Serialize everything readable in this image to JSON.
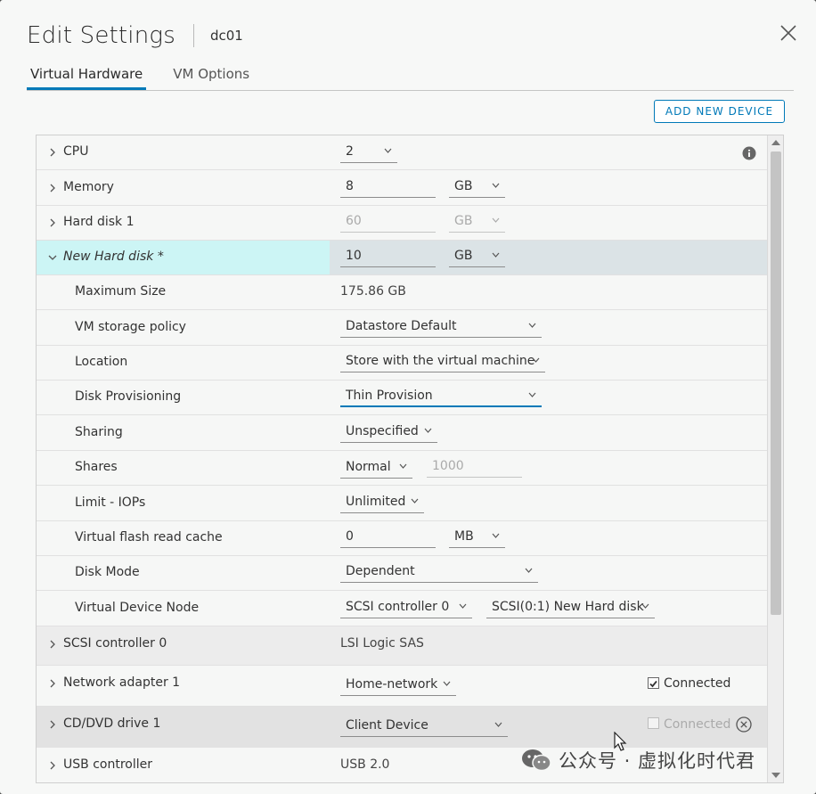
{
  "dialog": {
    "title": "Edit Settings",
    "vm_name": "dc01"
  },
  "tabs": [
    {
      "label": "Virtual Hardware",
      "active": true
    },
    {
      "label": "VM Options",
      "active": false
    }
  ],
  "add_device_label": "ADD NEW DEVICE",
  "hardware": {
    "cpu": {
      "label": "CPU",
      "value": "2"
    },
    "memory": {
      "label": "Memory",
      "value": "8",
      "unit": "GB"
    },
    "hard_disk_1": {
      "label": "Hard disk 1",
      "value": "60",
      "unit": "GB"
    },
    "new_hard_disk": {
      "label": "New Hard disk *",
      "value": "10",
      "unit": "GB",
      "max_size_label": "Maximum Size",
      "max_size_value": "175.86 GB",
      "storage_policy_label": "VM storage policy",
      "storage_policy_value": "Datastore Default",
      "location_label": "Location",
      "location_value": "Store with the virtual machine",
      "provisioning_label": "Disk Provisioning",
      "provisioning_value": "Thin Provision",
      "sharing_label": "Sharing",
      "sharing_value": "Unspecified",
      "shares_label": "Shares",
      "shares_value": "Normal",
      "shares_number": "1000",
      "limit_label": "Limit - IOPs",
      "limit_value": "Unlimited",
      "flash_label": "Virtual flash read cache",
      "flash_value": "0",
      "flash_unit": "MB",
      "disk_mode_label": "Disk Mode",
      "disk_mode_value": "Dependent",
      "node_label": "Virtual Device Node",
      "node_controller": "SCSI controller 0",
      "node_slot": "SCSI(0:1) New Hard disk"
    },
    "scsi": {
      "label": "SCSI controller 0",
      "value": "LSI Logic SAS"
    },
    "network": {
      "label": "Network adapter 1",
      "value": "Home-network",
      "connected_label": "Connected",
      "connected": true
    },
    "cdrom": {
      "label": "CD/DVD drive 1",
      "value": "Client Device",
      "connected_label": "Connected",
      "connected": false
    },
    "usb": {
      "label": "USB controller",
      "value": "USB 2.0"
    }
  },
  "watermark": {
    "text": "公众号 · 虚拟化时代君"
  },
  "colors": {
    "accent": "#0079b8",
    "selected_label_bg": "#ccf5f5",
    "selected_row_bg": "#dbe3e6"
  }
}
